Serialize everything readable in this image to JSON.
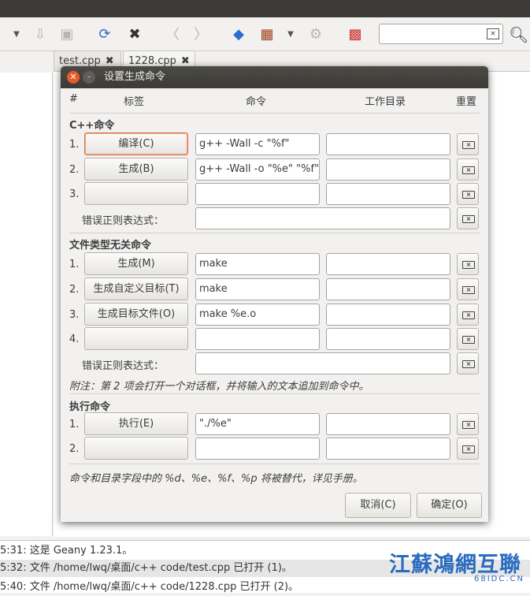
{
  "editor_tabs": [
    {
      "label": "test.cpp"
    },
    {
      "label": "1228.cpp"
    }
  ],
  "dialog": {
    "title": "设置生成命令",
    "columns": {
      "num": "#",
      "label": "标签",
      "command": "命令",
      "workdir": "工作目录",
      "reset": "重置"
    },
    "cpp_section": {
      "title": "C++命令",
      "rows": [
        {
          "num": "1.",
          "label": "编译(C)",
          "command": "g++ -Wall -c \"%f\"",
          "workdir": ""
        },
        {
          "num": "2.",
          "label": "生成(B)",
          "command": "g++ -Wall -o \"%e\" \"%f\"",
          "workdir": ""
        },
        {
          "num": "3.",
          "label": "",
          "command": "",
          "workdir": ""
        }
      ],
      "regex_label": "错误正则表达式：",
      "regex_value": ""
    },
    "independent_section": {
      "title": "文件类型无关命令",
      "rows": [
        {
          "num": "1.",
          "label": "生成(M)",
          "command": "make",
          "workdir": ""
        },
        {
          "num": "2.",
          "label": "生成自定义目标(T)",
          "command": "make",
          "workdir": ""
        },
        {
          "num": "3.",
          "label": "生成目标文件(O)",
          "command": "make %e.o",
          "workdir": ""
        },
        {
          "num": "4.",
          "label": "",
          "command": "",
          "workdir": ""
        }
      ],
      "regex_label": "错误正则表达式：",
      "regex_value": "",
      "note": "附注：第 2 项会打开一个对话框，并将输入的文本追加到命令中。"
    },
    "execute_section": {
      "title": "执行命令",
      "rows": [
        {
          "num": "1.",
          "label": "执行(E)",
          "command": "\"./%e\"",
          "workdir": ""
        },
        {
          "num": "2.",
          "label": "",
          "command": "",
          "workdir": ""
        }
      ]
    },
    "footer_note": "命令和目录字段中的 %d、%e、%f、%p 将被替代，详见手册。",
    "cancel_label": "取消(C)",
    "ok_label": "确定(O)"
  },
  "messages": [
    "5:31: 这是 Geany 1.23.1。",
    "5:32: 文件 /home/lwq/桌面/c++ code/test.cpp 已打开 (1)。",
    "5:40: 文件 /home/lwq/桌面/c++ code/1228.cpp 已打开 (2)。"
  ],
  "watermark": {
    "main": "江蘇鴻網互聯",
    "sub": "68IDC.CN"
  }
}
